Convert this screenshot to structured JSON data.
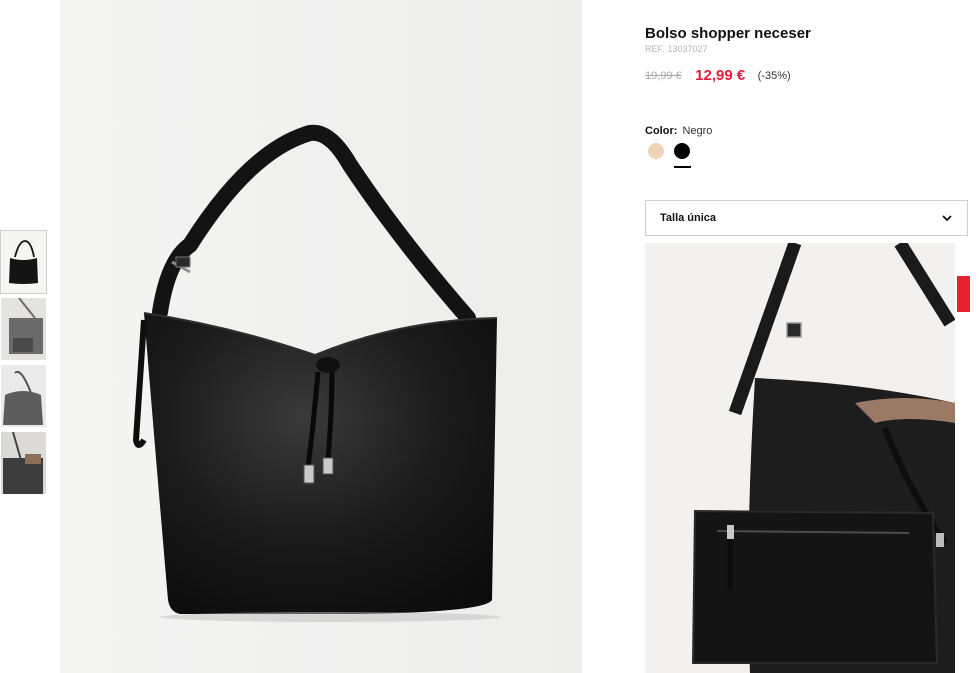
{
  "product": {
    "title": "Bolso shopper neceser",
    "ref_label": "REF.",
    "ref_number": "13037027",
    "old_price": "19,99 €",
    "new_price": "12,99 €",
    "discount": "(-35%)"
  },
  "color": {
    "label": "Color:",
    "selected": "Negro",
    "swatches": [
      {
        "name": "beige",
        "hex": "#f0d4b9"
      },
      {
        "name": "negro",
        "hex": "#000000"
      }
    ]
  },
  "size": {
    "selected": "Talla única",
    "icon": "chevron-down-icon"
  },
  "thumbnails": [
    {
      "icon": "bag-front-thumbnail"
    },
    {
      "icon": "bag-model-thumbnail"
    },
    {
      "icon": "bag-side-thumbnail"
    },
    {
      "icon": "bag-shoulder-thumbnail"
    }
  ],
  "colors": {
    "sale_price": "#e01e3c",
    "side_tab": "#e8212f"
  }
}
